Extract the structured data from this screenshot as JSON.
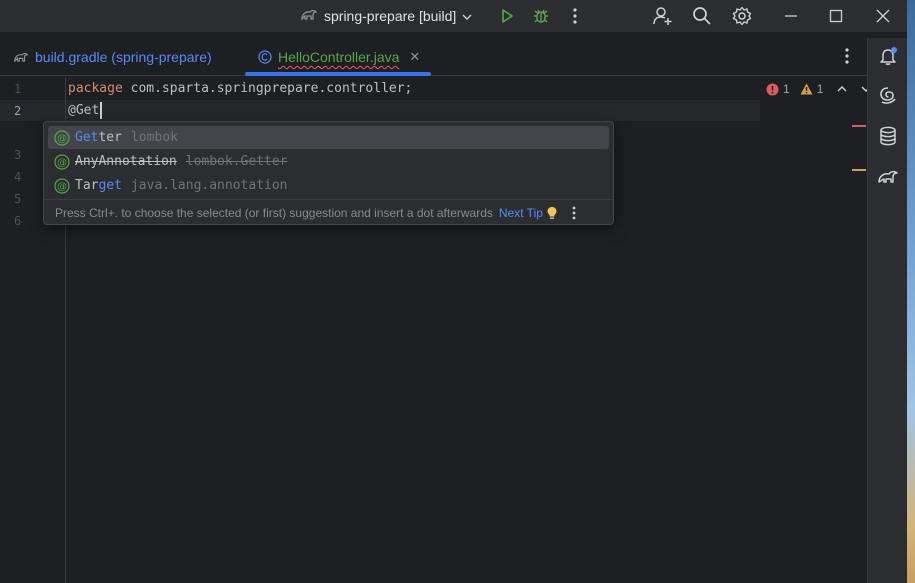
{
  "titlebar": {
    "run_config_label": "spring-prepare [build]",
    "icons": [
      "gradle-icon",
      "chevron-down-icon",
      "run-icon",
      "debug-icon",
      "more-icon",
      "add-user-icon",
      "search-icon",
      "settings-icon",
      "minimize-icon",
      "maximize-icon",
      "close-icon"
    ]
  },
  "tabs": [
    {
      "label": "build.gradle (spring-prepare)",
      "icon": "gradle-icon",
      "active": false
    },
    {
      "label": "HelloController.java",
      "icon": "class-icon",
      "active": true
    }
  ],
  "editor": {
    "line_numbers": [
      "1",
      "2",
      "3",
      "4",
      "5",
      "6"
    ],
    "current_line": "2",
    "code": {
      "line1_keyword": "package",
      "line1_rest": " com.sparta.springprepare.controller;",
      "line2": "@Get"
    },
    "inspections": {
      "errors": "1",
      "warnings": "1"
    }
  },
  "completion": {
    "items": [
      {
        "match": "Get",
        "rest": "ter",
        "tail": "lombok",
        "selected": true,
        "strikethrough": false
      },
      {
        "match": "",
        "rest": "AnyAnnotation",
        "tail": "lombok.Getter",
        "selected": false,
        "strikethrough": true
      },
      {
        "match_pre": "Tar",
        "match": "get",
        "tail": "java.lang.annotation",
        "selected": false,
        "strikethrough": false
      }
    ],
    "footer_text": "Press Ctrl+. to choose the selected (or first) suggestion and insert a dot afterwards",
    "footer_link": "Next Tip"
  },
  "toolstrip": {
    "icons": [
      "notifications-icon",
      "ai-assistant-icon",
      "database-icon",
      "gradle-elephant-icon"
    ]
  },
  "colors": {
    "accent": "#3574f0",
    "keyword": "#cf8e6d",
    "error": "#db5c5c",
    "warning": "#d6a343",
    "run_green": "#57a64a"
  }
}
